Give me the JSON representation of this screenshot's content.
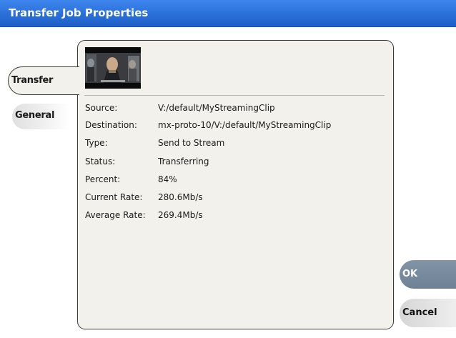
{
  "window": {
    "title": "Transfer Job Properties"
  },
  "tabs": [
    {
      "label": "Transfer",
      "active": true
    },
    {
      "label": "General",
      "active": false
    }
  ],
  "thumbnail": {
    "icon": "clip-thumbnail-image"
  },
  "properties": [
    {
      "label": "Source:",
      "value": "V:/default/MyStreamingClip"
    },
    {
      "label": "Destination:",
      "value": "mx-proto-10/V:/default/MyStreamingClip"
    },
    {
      "label": "Type:",
      "value": "Send to Stream"
    },
    {
      "label": "Status:",
      "value": "Transferring"
    },
    {
      "label": "Percent:",
      "value": "84%"
    },
    {
      "label": "Current Rate:",
      "value": "280.6Mb/s"
    },
    {
      "label": "Average Rate:",
      "value": "269.4Mb/s"
    }
  ],
  "buttons": {
    "ok_label": "OK",
    "cancel_label": "Cancel"
  },
  "colors": {
    "titlebar": "#2a6fd8",
    "panel": "#f3f1ec",
    "ok_button": "#7a8ca0"
  }
}
